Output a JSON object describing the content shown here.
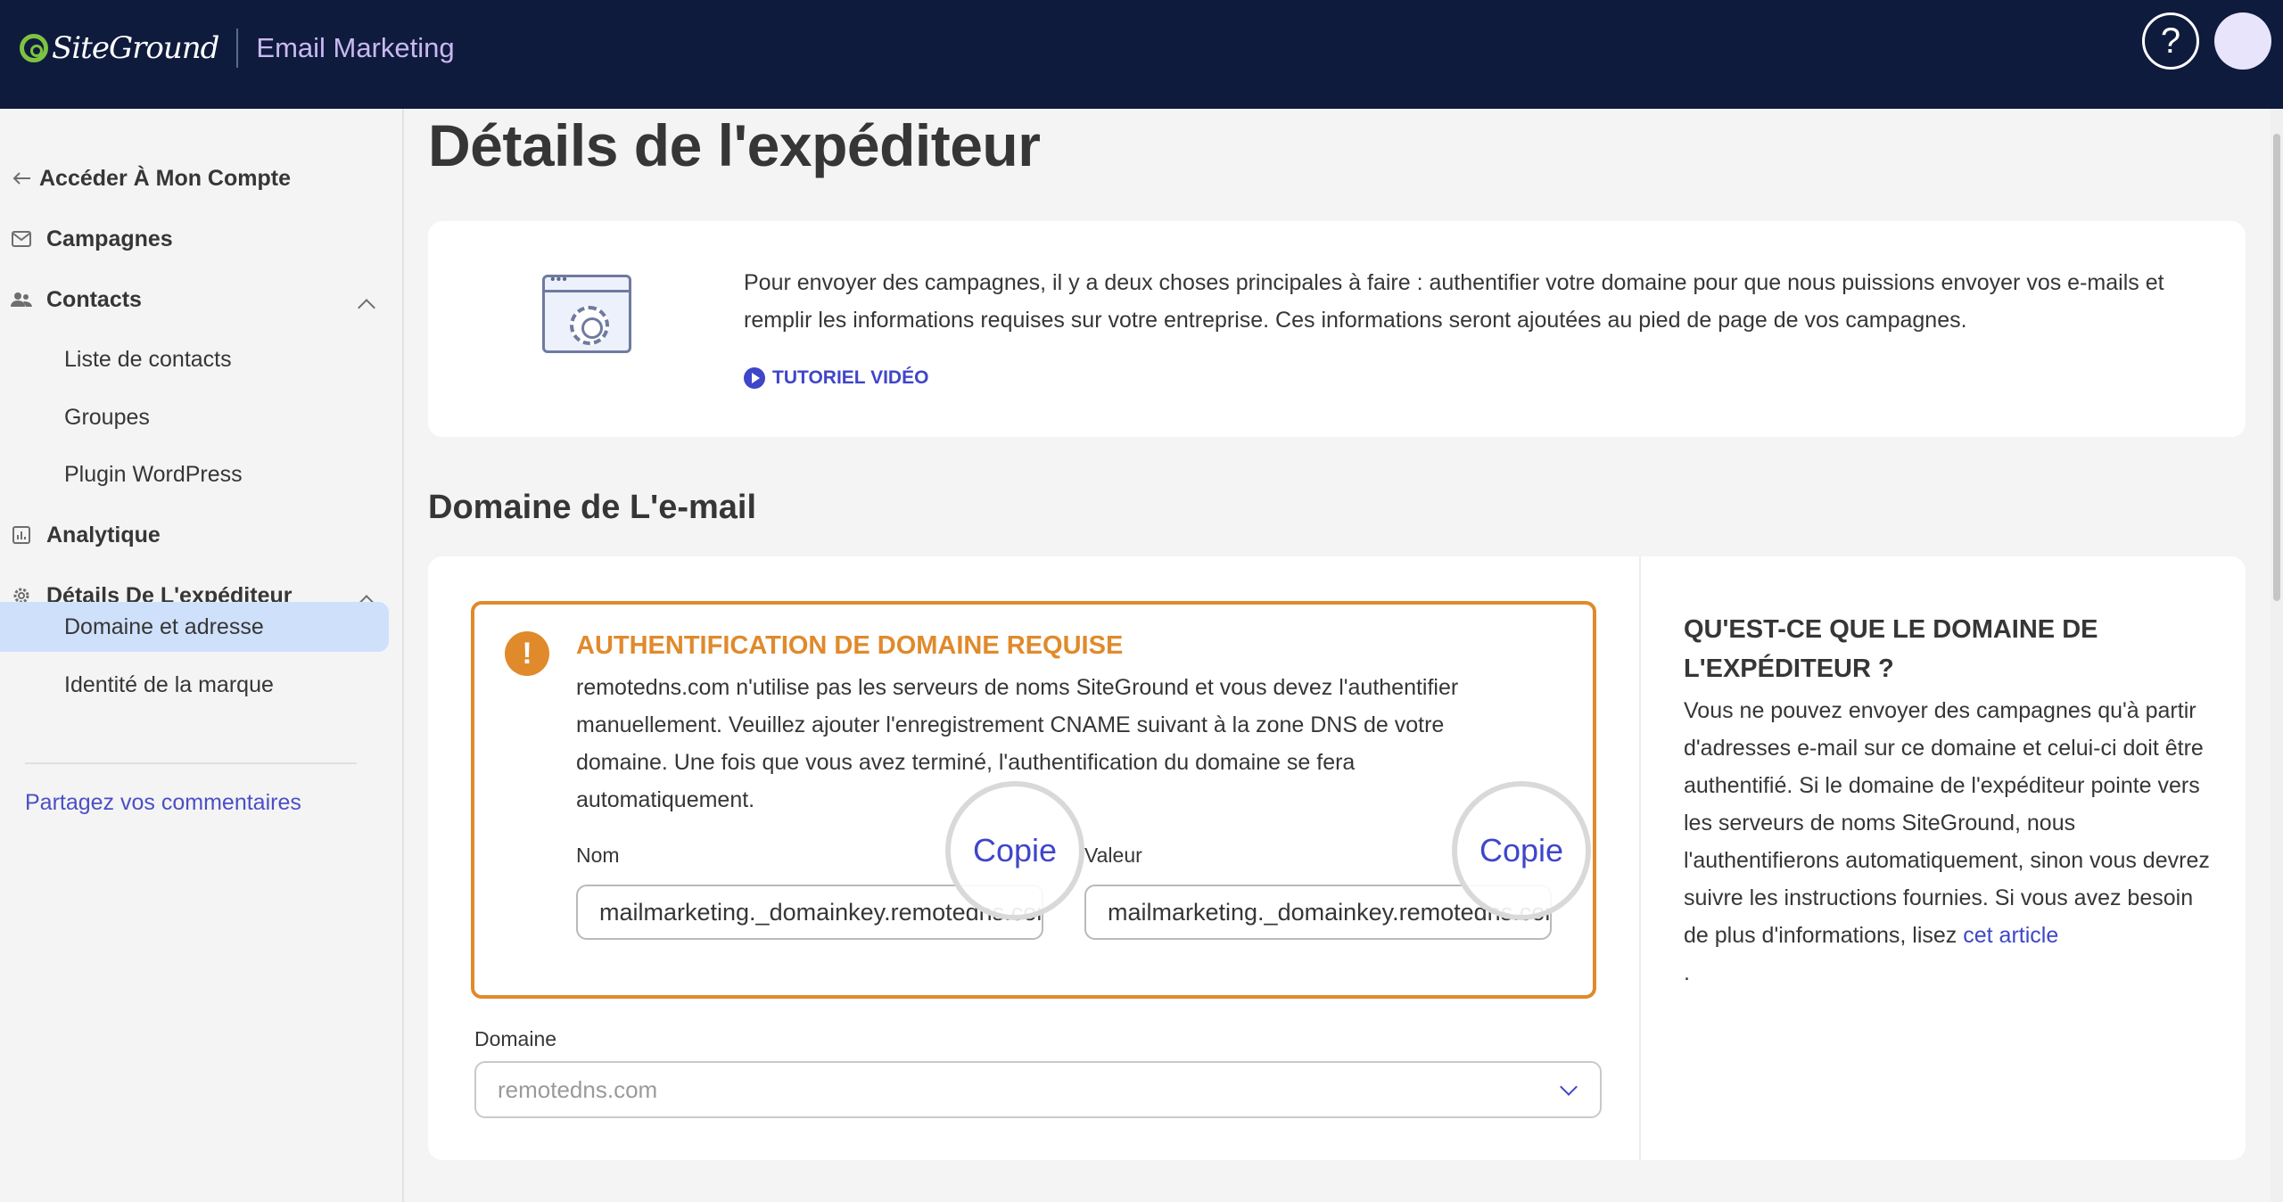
{
  "header": {
    "brand": "SiteGround",
    "product": "Email Marketing",
    "help_glyph": "?"
  },
  "sidebar": {
    "back_label": "Accéder À Mon Compte",
    "items": [
      {
        "label": "Campagnes",
        "icon": "mail-icon"
      },
      {
        "label": "Contacts",
        "icon": "users-icon"
      },
      {
        "label": "Analytique",
        "icon": "chart-icon"
      },
      {
        "label": "Détails De L'expéditeur",
        "icon": "gear-icon"
      }
    ],
    "contacts_sub": [
      "Liste de contacts",
      "Groupes",
      "Plugin WordPress"
    ],
    "sender_sub": [
      "Domaine et adresse",
      "Identité de la marque"
    ],
    "active_sub": "Domaine et adresse",
    "feedback": "Partagez vos commentaires"
  },
  "page": {
    "title": "Détails de l'expéditeur",
    "intro_text": "Pour envoyer des campagnes, il y a deux choses principales à faire : authentifier votre domaine pour que nous puissions envoyer vos e-mails et remplir les informations requises sur votre entreprise. Ces informations seront ajoutées au pied de page de vos campagnes.",
    "tutorial_label": "TUTORIEL VIDÉO",
    "section_title": "Domaine de L'e-mail"
  },
  "alert": {
    "title": "AUTHENTIFICATION DE DOMAINE REQUISE",
    "text": "remotedns.com n'utilise pas les serveurs de noms SiteGround et vous devez l'authentifier manuellement. Veuillez ajouter l'enregistrement CNAME suivant à la zone DNS de votre domaine. Une fois que vous avez terminé, l'authentification du domaine se fera automatiquement.",
    "name_label": "Nom",
    "name_value": "mailmarketing._domainkey.remotedns.com",
    "value_label": "Valeur",
    "value_value": "mailmarketing._domainkey.remotedns.com",
    "copy_label": "Copie"
  },
  "domain_field": {
    "label": "Domaine",
    "selected": "remotedns.com"
  },
  "info": {
    "title": "QU'EST-CE QUE LE DOMAINE DE L'EXPÉDITEUR ?",
    "text": "Vous ne pouvez envoyer des campagnes qu'à partir d'adresses e-mail sur ce domaine et celui-ci doit être authentifié. Si le domaine de l'expéditeur pointe vers les serveurs de noms SiteGround, nous l'authentifierons automatiquement, sinon vous devrez suivre les instructions fournies. Si vous avez besoin de plus d'informations, lisez",
    "link": "cet article",
    "end": "."
  },
  "colors": {
    "header_bg": "#0f1b3d",
    "accent": "#3f46c8",
    "warning": "#e08a2c",
    "active_bg": "#cfe0fb"
  }
}
